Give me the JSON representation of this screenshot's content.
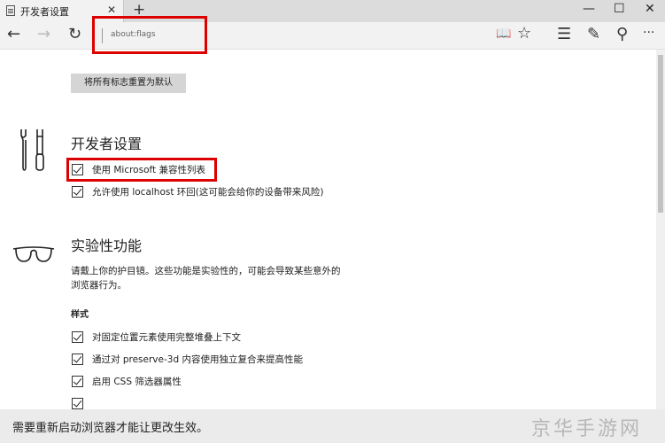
{
  "window": {
    "tab_title": "开发者设置",
    "tab_close": "✕",
    "new_tab": "+",
    "minimize": "—",
    "maximize": "☐",
    "close": "✕"
  },
  "navbar": {
    "back": "←",
    "forward": "→",
    "refresh": "↻",
    "address": "about:flags",
    "reading_view": "📖",
    "favorite": "☆",
    "hub": "☰",
    "web_note": "✎",
    "share": "⚲",
    "more": "···"
  },
  "content": {
    "reset_button": "将所有标志重置为默认",
    "developer": {
      "title": "开发者设置",
      "icon": "tools-icon",
      "options": [
        {
          "label": "使用 Microsoft 兼容性列表",
          "checked": true
        },
        {
          "label": "允许使用 localhost 环回(这可能会给你的设备带来风险)",
          "checked": true
        }
      ]
    },
    "experimental": {
      "title": "实验性功能",
      "icon": "glasses-icon",
      "description": "请戴上你的护目镜。这些功能是实验性的，可能会导致某些意外的浏览器行为。",
      "style_heading": "样式",
      "options": [
        {
          "label": "对固定位置元素使用完整堆叠上下文",
          "checked": true
        },
        {
          "label": "通过对 preserve-3d 内容使用独立复合来提高性能",
          "checked": true
        },
        {
          "label": "启用 CSS 筛选器属性",
          "checked": true
        }
      ]
    }
  },
  "notification": {
    "text": "需要重新启动浏览器才能让更改生效。"
  },
  "watermark": "京华手游网",
  "colors": {
    "highlight": "#dd0000",
    "reset_button_bg": "#d5d5d5"
  }
}
